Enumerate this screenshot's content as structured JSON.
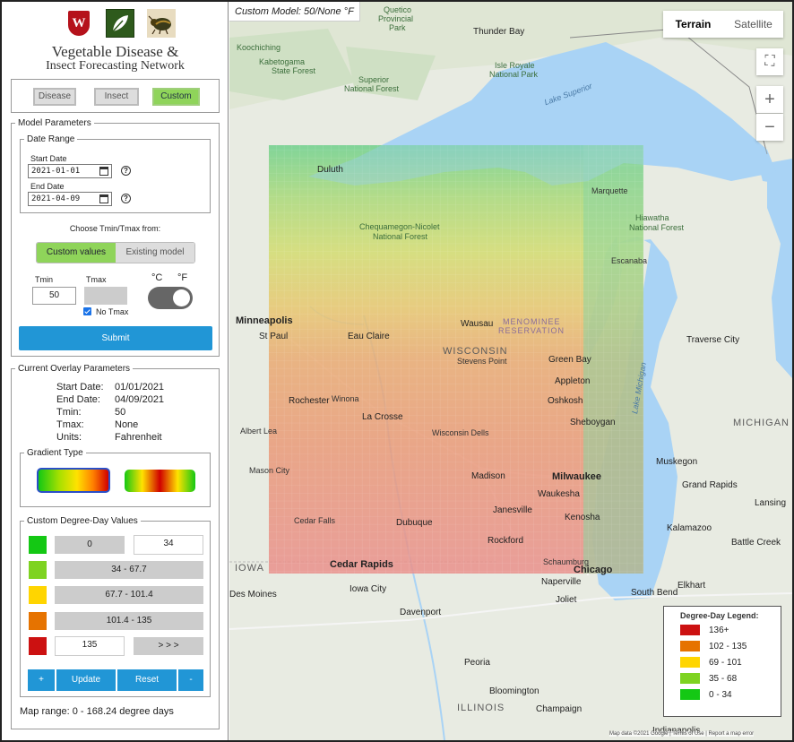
{
  "header": {
    "logo_text": "W",
    "title_line1": "Vegetable Disease &",
    "title_line2": "Insect Forecasting Network"
  },
  "model_tabs": [
    {
      "label": "Disease",
      "active": false
    },
    {
      "label": "Insect",
      "active": false
    },
    {
      "label": "Custom",
      "active": true
    }
  ],
  "model_parameters": {
    "legend": "Model Parameters",
    "date_range_legend": "Date Range",
    "start_label": "Start Date",
    "start_value": "2021-01-01",
    "end_label": "End Date",
    "end_value": "2021-04-09",
    "help_glyph": "?",
    "choose_label": "Choose Tmin/Tmax from:",
    "source_options": [
      {
        "label": "Custom values",
        "selected": true
      },
      {
        "label": "Existing model",
        "selected": false
      }
    ],
    "tmin_label": "Tmin",
    "tmin_value": "50",
    "tmax_label": "Tmax",
    "tmax_value": "",
    "no_tmax_label": "No Tmax",
    "no_tmax_checked": true,
    "unit_c": "°C",
    "unit_f": "°F",
    "unit_selected": "F",
    "submit_label": "Submit"
  },
  "overlay": {
    "legend": "Current Overlay Parameters",
    "rows": [
      {
        "key": "Start Date:",
        "value": "01/01/2021"
      },
      {
        "key": "End Date:",
        "value": "04/09/2021"
      },
      {
        "key": "Tmin:",
        "value": "50"
      },
      {
        "key": "Tmax:",
        "value": "None"
      },
      {
        "key": "Units:",
        "value": "Fahrenheit"
      }
    ]
  },
  "gradient": {
    "legend": "Gradient Type",
    "selected": 0
  },
  "custom_dd": {
    "legend": "Custom Degree-Day Values",
    "rows": [
      {
        "color": "#14c814",
        "range": "0",
        "input": "34"
      },
      {
        "color": "#7ed321",
        "range": "34 - 67.7"
      },
      {
        "color": "#ffd500",
        "range": "67.7 - 101.4"
      },
      {
        "color": "#e67300",
        "range": "101.4 - 135"
      },
      {
        "color": "#cc1111",
        "input": "135",
        "more": "> > >"
      }
    ],
    "buttons": {
      "plus": "+",
      "update": "Update",
      "reset": "Reset",
      "minus": "-"
    }
  },
  "map_range": "Map range: 0 - 168.24 degree days",
  "map": {
    "model_tag": "Custom Model: 50/None °F",
    "map_types": [
      "Terrain",
      "Satellite"
    ],
    "selected_map_type": "Terrain",
    "fullscreen_glyph": "⛶",
    "zoom_in": "+",
    "zoom_out": "−",
    "attribution": "Map data ©2021 Google | Terms of Use | Report a map error",
    "labels": {
      "koochiching": "Koochiching",
      "kabetogama1": "Kabetogama",
      "kabetogama2": "State Forest",
      "superior1": "Superior",
      "superior2": "National Forest",
      "thunderbay": "Thunder Bay",
      "isleroyale1": "Isle Royale",
      "isleroyale2": "National Park",
      "lakesuperior": "Lake Superior",
      "quetico1": "Quetico",
      "quetico2": "Provincial",
      "quetico3": "Park",
      "duluth": "Duluth",
      "chequamegon1": "Chequamegon-Nicolet",
      "chequamegon2": "National Forest",
      "hiawatha1": "Hiawatha",
      "hiawatha2": "National Forest",
      "menominee1": "MENOMINEE",
      "menominee2": "RESERVATION",
      "minneapolis": "Minneapolis",
      "stpaul": "St Paul",
      "wisconsin": "WISCONSIN",
      "michigan": "MICHIGAN",
      "iowa": "IOWA",
      "illinois": "ILLINOIS",
      "eauclaire": "Eau Claire",
      "wausau": "Wausau",
      "greenbay": "Green Bay",
      "appleton": "Appleton",
      "oshkosh": "Oshkosh",
      "sheboygan": "Sheboygan",
      "rochester": "Rochester",
      "lacrosse": "La Crosse",
      "madison": "Madison",
      "milwaukee": "Milwaukee",
      "waukesha": "Waukesha",
      "janesville": "Janesville",
      "kenosha": "Kenosha",
      "rockford": "Rockford",
      "dubuque": "Dubuque",
      "cedarrapids": "Cedar Rapids",
      "cedarfalls": "Cedar Falls",
      "chicago": "Chicago",
      "schaumburg": "Schaumburg",
      "naperville": "Naperville",
      "joliet": "Joliet",
      "desmoines": "Des Moines",
      "iowacity": "Iowa City",
      "davenport": "Davenport",
      "peoria": "Peoria",
      "bloomington": "Bloomington",
      "champaign": "Champaign",
      "grandrapids": "Grand Rapids",
      "kalamazoo": "Kalamazoo",
      "battlecreek": "Battle Creek",
      "lansing": "Lansing",
      "southbend": "South Bend",
      "elkhart": "Elkhart",
      "muskegon": "Muskegon",
      "traversecity": "Traverse City",
      "lakemichigan": "Lake Michigan",
      "masoncity": "Mason City",
      "albertlea": "Albert Lea",
      "winona": "Winona",
      "stevenspoint": "Stevens Point",
      "wisconsindells": "Wisconsin Dells",
      "marquette": "Marquette",
      "escanaba": "Escanaba",
      "indianapolis": "Indianapolis"
    },
    "legend": {
      "title": "Degree-Day Legend:",
      "items": [
        {
          "color": "#cc1111",
          "label": "136+"
        },
        {
          "color": "#e67300",
          "label": "102 - 135"
        },
        {
          "color": "#ffd500",
          "label": "69 - 101"
        },
        {
          "color": "#7ed321",
          "label": "35 - 68"
        },
        {
          "color": "#14c814",
          "label": "0 - 34"
        }
      ]
    }
  }
}
